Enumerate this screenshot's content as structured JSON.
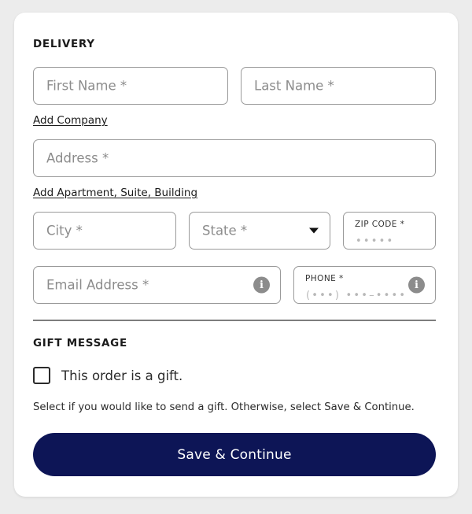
{
  "card": {
    "delivery": {
      "section_title": "DELIVERY",
      "fields": {
        "first_name": {
          "placeholder": "First Name *"
        },
        "last_name": {
          "placeholder": "Last Name *"
        },
        "address": {
          "placeholder": "Address *"
        },
        "city": {
          "placeholder": "City *"
        },
        "state": {
          "placeholder": "State *"
        },
        "zip": {
          "label": "ZIP CODE *",
          "value": "•••••"
        },
        "email": {
          "placeholder": "Email Address *"
        },
        "phone": {
          "label": "PHONE *",
          "value": "(•••) •••–••••"
        }
      },
      "links": {
        "add_company": "Add Company",
        "add_apartment": "Add Apartment, Suite, Building"
      }
    },
    "gift": {
      "section_title": "GIFT MESSAGE",
      "checkbox_label": "This order is a gift.",
      "checkbox_checked": false,
      "helper_text": "Select if you would like to send a gift. Otherwise, select Save & Continue."
    },
    "actions": {
      "save_continue": "Save & Continue"
    }
  },
  "colors": {
    "page_background": "#ececec",
    "card_background": "#ffffff",
    "primary_button": "#0d1556",
    "field_border": "#9a9a9a",
    "placeholder_text": "#8c8c8c",
    "info_icon": "#8c8c8c",
    "divider": "#7d7d7d"
  }
}
